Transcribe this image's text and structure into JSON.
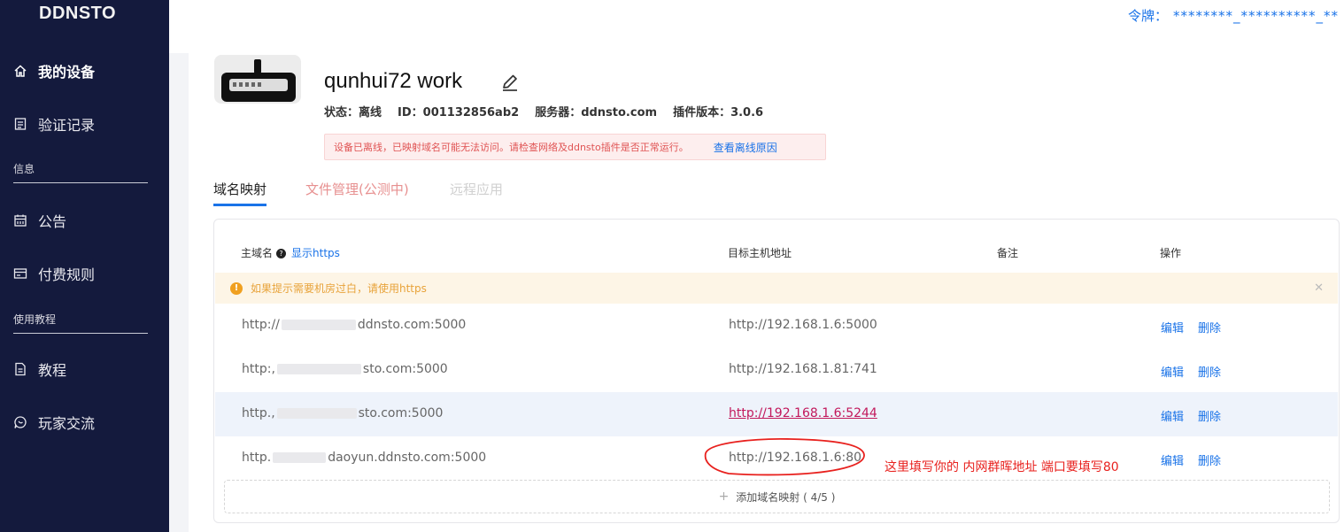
{
  "sidebar": {
    "brand": "DDNSTO",
    "items": [
      {
        "label": "我的设备",
        "icon": "home-icon"
      },
      {
        "label": "验证记录",
        "icon": "list-icon"
      },
      {
        "label": "公告",
        "icon": "calendar-icon"
      },
      {
        "label": "付费规则",
        "icon": "card-icon"
      },
      {
        "label": "教程",
        "icon": "document-icon"
      },
      {
        "label": "玩家交流",
        "icon": "chat-icon"
      }
    ],
    "sections": [
      "信息",
      "使用教程"
    ]
  },
  "header": {
    "token_label": "令牌：",
    "token_value": "********_**********_**"
  },
  "device": {
    "name": "qunhui72 work",
    "status": "状态：离线",
    "id": "ID：001132856ab2",
    "server": "服务器：ddnsto.com",
    "plugin_version": "插件版本：3.0.6",
    "alert_message": "设备已离线，已映射域名可能无法访问。请检查网络及ddnsto插件是否正常运行。",
    "alert_link": "查看离线原因"
  },
  "tabs": [
    "域名映射",
    "文件管理(公测中)",
    "远程应用"
  ],
  "table": {
    "headers": {
      "domain": "主域名",
      "show_https": "显示https",
      "target": "目标主机地址",
      "remark": "备注",
      "action": "操作"
    },
    "notice": "如果提示需要机房过白，请使用https",
    "rows": [
      {
        "domain_prefix": "http://",
        "domain_suffix": "ddnsto.com:5000",
        "target": "http://192.168.1.6:5000",
        "remark": ""
      },
      {
        "domain_prefix": "http:,",
        "domain_suffix": "sto.com:5000",
        "target": "http://192.168.1.81:741",
        "remark": ""
      },
      {
        "domain_prefix": "http.,",
        "domain_suffix": "sto.com:5000",
        "target": "http://192.168.1.6:5244",
        "remark": ""
      },
      {
        "domain_prefix": "http.",
        "domain_suffix": "daoyun.ddnsto.com:5000",
        "target": "http://192.168.1.6:80",
        "remark": ""
      }
    ],
    "edit_label": "编辑",
    "delete_label": "删除",
    "add_label": "添加域名映射 ( 4/5 )"
  },
  "annotation": {
    "text": "这里填写你的 内网群晖地址 端口要填写80",
    "color": "#e8211e"
  },
  "colors": {
    "sidebar_bg": "#141a3d",
    "accent": "#1a73e8",
    "alert_bg": "#fdeeee",
    "notice_bg": "#fdf5e6"
  }
}
